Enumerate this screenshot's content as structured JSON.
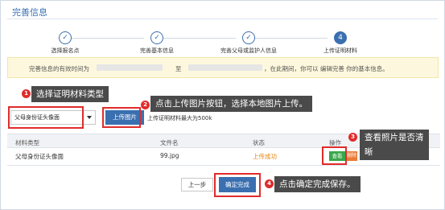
{
  "page": {
    "title": "完善信息"
  },
  "stepper": {
    "steps": [
      {
        "label": "选择报名点",
        "state": "done",
        "mark": "✓"
      },
      {
        "label": "完善基本信息",
        "state": "done",
        "mark": "✓"
      },
      {
        "label": "完善父母或监护人信息",
        "state": "done",
        "mark": "✓"
      },
      {
        "label": "上传证明材料",
        "state": "current",
        "mark": "4"
      }
    ]
  },
  "notice": {
    "prefix": "完善信息的有效时间为",
    "middle": "至",
    "suffix": "，在此期间，你可以 编辑完善 你的基本信息。"
  },
  "material": {
    "type_selected": "父母身份证头像面",
    "upload_label": "上传图片",
    "hint": "上传证明材料最大为500k"
  },
  "table": {
    "headers": [
      "材料类型",
      "文件名",
      "状态",
      "操作"
    ],
    "rows": [
      {
        "type": "父母身份证头像面",
        "filename": "99.jpg",
        "status": "上传成功",
        "view": "查看",
        "delete": "删除"
      }
    ]
  },
  "footer": {
    "prev_label": "上一步",
    "done_label": "确定完成"
  },
  "callouts": {
    "c1": {
      "num": "1",
      "text": "选择证明材料类型"
    },
    "c2": {
      "num": "2",
      "text": "点击上传图片按钮，选择本地图片上传。"
    },
    "c3": {
      "num": "3",
      "text_line1": "查看照片是否清",
      "text_line2": "晰"
    },
    "c4": {
      "num": "4",
      "text": "点击确定完成保存。"
    }
  },
  "colors": {
    "primary": "#3a6fb0",
    "highlight": "#e02b2b",
    "success": "#3aa64a",
    "danger": "#ea7b35",
    "status_ok": "#e8860f"
  }
}
